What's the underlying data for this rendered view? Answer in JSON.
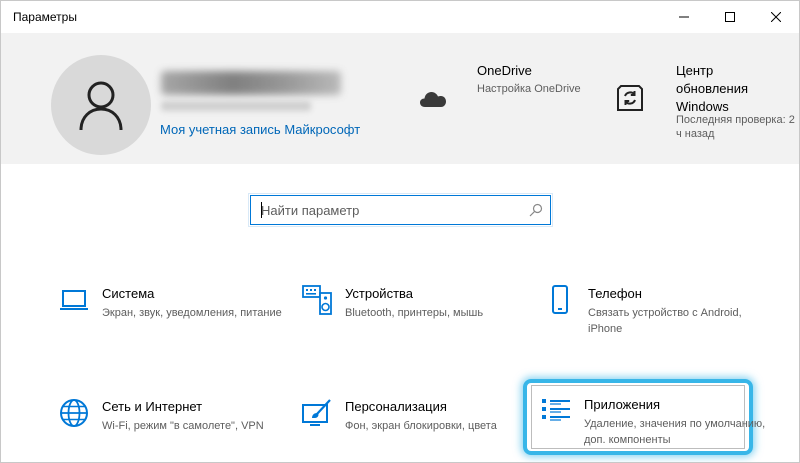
{
  "window": {
    "title": "Параметры"
  },
  "header": {
    "account_link": "Моя учетная запись Майкрософт",
    "onedrive": {
      "icon": "cloud-icon",
      "title": "OneDrive",
      "subtitle": "Настройка OneDrive"
    },
    "update": {
      "icon": "sync-icon",
      "title": "Центр обновления Windows",
      "subtitle": "Последняя проверка: 2 ч назад"
    }
  },
  "search": {
    "placeholder": "Найти параметр",
    "value": ""
  },
  "categories": [
    {
      "icon": "laptop-icon",
      "name": "Система",
      "description": "Экран, звук, уведомления, питание"
    },
    {
      "icon": "keyboard-speaker-icon",
      "name": "Устройства",
      "description": "Bluetooth, принтеры, мышь"
    },
    {
      "icon": "phone-icon",
      "name": "Телефон",
      "description": "Связать устройство с Android, iPhone"
    },
    {
      "icon": "globe-icon",
      "name": "Сеть и Интернет",
      "description": "Wi-Fi, режим \"в самолете\", VPN"
    },
    {
      "icon": "paint-brush-icon",
      "name": "Персонализация",
      "description": "Фон, экран блокировки, цвета"
    },
    {
      "icon": "apps-list-icon",
      "name": "Приложения",
      "description": "Удаление, значения по умолчанию, доп. компоненты"
    }
  ],
  "colors": {
    "accent": "#0078d7",
    "link": "#0067b8",
    "highlight": "#38b6e8",
    "header_bg": "#f2f2f2"
  }
}
